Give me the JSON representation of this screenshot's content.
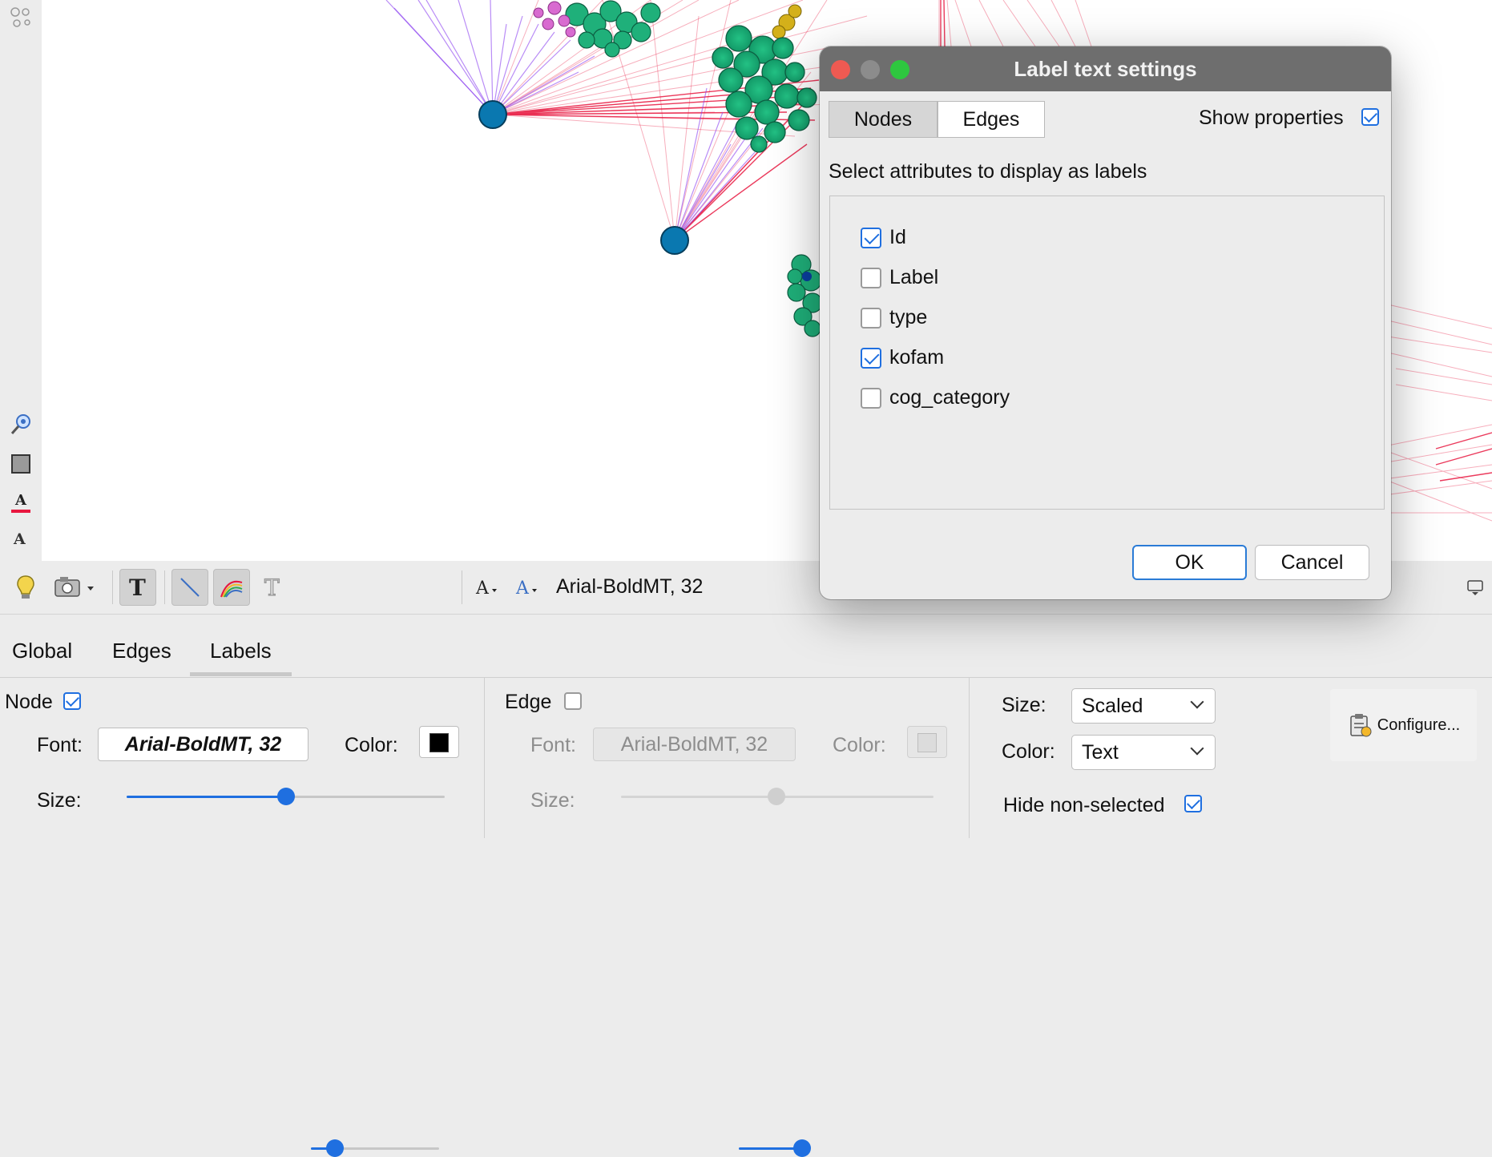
{
  "toolbar": {
    "font_readout": "Arial-BoldMT, 32"
  },
  "bottom_tabs": [
    "Global",
    "Edges",
    "Labels"
  ],
  "settings": {
    "node": {
      "label": "Node",
      "checked": true,
      "font_label": "Font:",
      "font_value": "Arial-BoldMT, 32",
      "color_label": "Color:",
      "size_label": "Size:",
      "color": "#000000"
    },
    "edge": {
      "label": "Edge",
      "checked": false,
      "font_label": "Font:",
      "font_value": "Arial-BoldMT, 32",
      "color_label": "Color:",
      "size_label": "Size:"
    },
    "size_mode_label": "Size:",
    "size_mode_value": "Scaled",
    "color_mode_label": "Color:",
    "color_mode_value": "Text",
    "hide_non_selected_label": "Hide non-selected",
    "hide_non_selected_checked": true,
    "configure_label": "Configure..."
  },
  "dialog": {
    "title": "Label text settings",
    "tabs": [
      "Nodes",
      "Edges"
    ],
    "selected_tab": "Nodes",
    "show_properties_label": "Show properties",
    "show_properties_checked": true,
    "instruction": "Select attributes to display as labels",
    "attributes": [
      {
        "label": "Id",
        "checked": true
      },
      {
        "label": "Label",
        "checked": false
      },
      {
        "label": "type",
        "checked": false
      },
      {
        "label": "kofam",
        "checked": true
      },
      {
        "label": "cog_category",
        "checked": false
      }
    ],
    "ok_label": "OK",
    "cancel_label": "Cancel"
  },
  "colors": {
    "accent": "#1f6fe0",
    "edge_red": "#e8173f",
    "edge_purple": "#8a3ff0",
    "node_green": "#1fb07a",
    "node_blue": "#0a78b0",
    "titlebar": "#6e6e6e"
  },
  "icons": {
    "strip": [
      "graph-layout-icon",
      "zoom-icon",
      "background-color-icon",
      "font-color-icon",
      "font-icon"
    ],
    "toolbar": [
      "lightbulb-icon",
      "screenshot-icon",
      "show-labels-icon",
      "edge-line-icon",
      "edge-color-icon",
      "label-text-icon",
      "font-size-icon",
      "font-color-icon"
    ]
  }
}
